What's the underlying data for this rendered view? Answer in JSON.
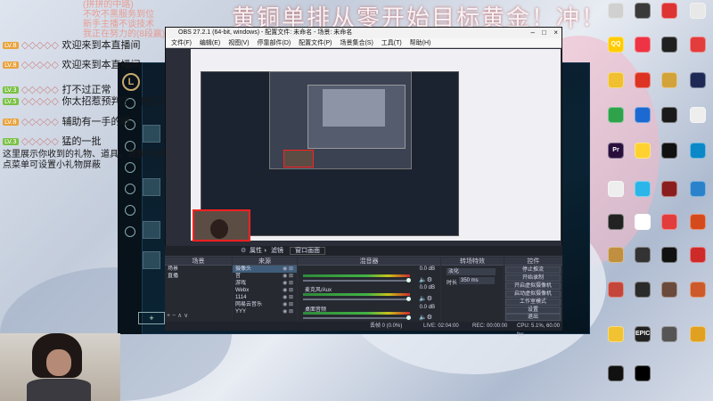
{
  "overlay": {
    "title": "黄铜单排从零开始目标黄金！冲！",
    "top_left_lines": [
      "(拼拼的中路)",
      "不吹不黑服务到位",
      "新手主播不谈技术",
      "我正在努力的(8段赢)"
    ],
    "chat": [
      {
        "badge": "LV.8",
        "name": "",
        "text": "欢迎来到本直播间"
      },
      {
        "badge": "LV.8",
        "name": "",
        "text": "欢迎来到本直播间"
      },
      {
        "badge": "LV.3",
        "name": "",
        "text": "打不过正常"
      },
      {
        "badge": "LV.5",
        "name": "",
        "text": "你太招惹预判了，他们仅能抵御"
      },
      {
        "badge": "LV.8",
        "name": "",
        "text": "辅助有一手的呀"
      },
      {
        "badge": "LV.3",
        "name": "",
        "text": "猛的一批"
      }
    ],
    "notice": [
      "这里展示你收到的礼物、道具、贵族开通",
      "点菜单可设置小礼物屏蔽"
    ]
  },
  "obs": {
    "window_title": "OBS 27.2.1 (64-bit, windows) - 配置文件: 未命名 - 场景: 未命名",
    "menu": [
      "文件(F)",
      "编辑(E)",
      "视图(V)",
      "停靠部件(D)",
      "配置文件(P)",
      "场景集合(S)",
      "工具(T)",
      "帮助(H)"
    ],
    "scene_bar": {
      "audio_label": "属性",
      "filter_label": "滤镜",
      "fullscreen_label": "窗口画面"
    },
    "docks": {
      "scenes": {
        "title": "场景",
        "items": [
          "场景",
          "直播"
        ]
      },
      "sources": {
        "title": "来源",
        "items": [
          "摄像头",
          "音",
          "游戏",
          "Webx",
          "1114",
          "网易云音乐",
          "YYY"
        ]
      },
      "mixer": {
        "title": "混音器",
        "channels": [
          {
            "name": "",
            "level_db": "0.0 dB"
          },
          {
            "name": "麦克风/Aux",
            "level_db": "0.0 dB"
          },
          {
            "name": "桌面音频",
            "level_db": "0.0 dB"
          }
        ]
      },
      "transitions": {
        "title": "转场特效",
        "type": "淡化",
        "duration_label": "时长",
        "duration": "350 ms"
      },
      "controls": {
        "title": "控件",
        "buttons": [
          "停止推流",
          "开始录制",
          "开启虚拟摄像机",
          "启动虚拟摄像机",
          "工作室模式",
          "设置",
          "退出"
        ]
      }
    },
    "status": {
      "dropped": "丢帧 0 (0.0%)",
      "live": "LIVE: 02:04:00",
      "rec": "REC: 00:00:00",
      "cpu": "CPU: 5.1%, 60.00 fps"
    }
  },
  "desktop_icons": [
    {
      "label": "",
      "color": "#d0d0d0"
    },
    {
      "label": "",
      "color": "#3a3a3a"
    },
    {
      "label": "",
      "color": "#dd3333"
    },
    {
      "label": "",
      "color": "#e8e8e8"
    },
    {
      "label": "QQ",
      "color": "#ffcc00"
    },
    {
      "label": "",
      "color": "#ee3344"
    },
    {
      "label": "",
      "color": "#202020"
    },
    {
      "label": "",
      "color": "#e23c3c"
    },
    {
      "label": "",
      "color": "#f0c030"
    },
    {
      "label": "",
      "color": "#dd3322"
    },
    {
      "label": "",
      "color": "#d2a23b"
    },
    {
      "label": "",
      "color": "#1e2a55"
    },
    {
      "label": "",
      "color": "#2ea34c"
    },
    {
      "label": "",
      "color": "#1c6ad1"
    },
    {
      "label": "",
      "color": "#1a1a1a"
    },
    {
      "label": "",
      "color": "#eeeeee"
    },
    {
      "label": "Pr",
      "color": "#2a0f3d"
    },
    {
      "label": "",
      "color": "#ffd230"
    },
    {
      "label": "",
      "color": "#111111"
    },
    {
      "label": "",
      "color": "#0a88c8"
    },
    {
      "label": "",
      "color": "#eeeeee"
    },
    {
      "label": "",
      "color": "#2bb5e8"
    },
    {
      "label": "",
      "color": "#8a1d1d"
    },
    {
      "label": "",
      "color": "#2a82ca"
    },
    {
      "label": "",
      "color": "#222222"
    },
    {
      "label": "",
      "color": "#ffffff"
    },
    {
      "label": "",
      "color": "#e23c3c"
    },
    {
      "label": "",
      "color": "#d44a1c"
    },
    {
      "label": "",
      "color": "#c09040"
    },
    {
      "label": "",
      "color": "#333333"
    },
    {
      "label": "",
      "color": "#111111"
    },
    {
      "label": "",
      "color": "#ce2a2a"
    },
    {
      "label": "",
      "color": "#c4453a"
    },
    {
      "label": "",
      "color": "#2b2b2b"
    },
    {
      "label": "",
      "color": "#6a4a3a"
    },
    {
      "label": "",
      "color": "#cc5a2a"
    },
    {
      "label": "",
      "color": "#f1c232"
    },
    {
      "label": "EPIC",
      "color": "#222222"
    },
    {
      "label": "",
      "color": "#555555"
    },
    {
      "label": "",
      "color": "#e0a020"
    },
    {
      "label": "",
      "color": "#111111"
    },
    {
      "label": "",
      "color": "#000000"
    }
  ]
}
